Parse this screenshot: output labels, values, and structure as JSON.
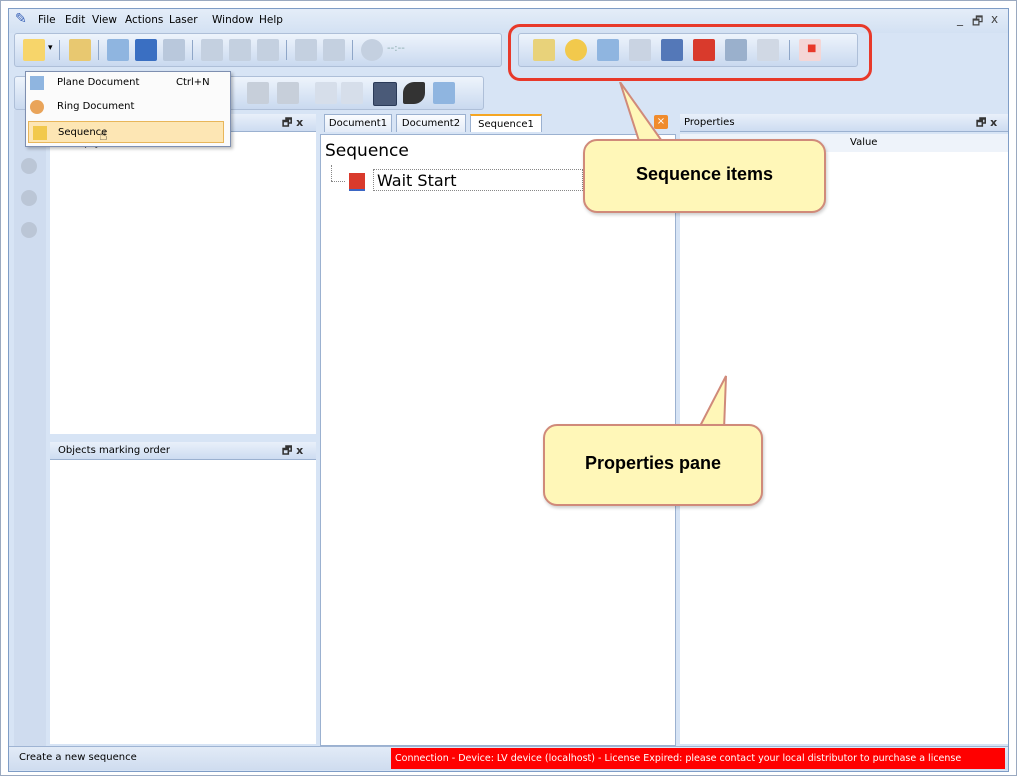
{
  "menu": {
    "items": [
      "File",
      "Edit",
      "View",
      "Actions",
      "Laser",
      "Window",
      "Help"
    ],
    "window_controls": [
      "_",
      "🗗",
      "x"
    ]
  },
  "new_menu": {
    "items": [
      {
        "label": "Plane Document",
        "shortcut": "Ctrl+N"
      },
      {
        "label": "Ring Document",
        "shortcut": ""
      },
      {
        "label": "Sequence",
        "shortcut": ""
      }
    ]
  },
  "left_pane": {
    "empty_text": "<empty>",
    "pin_close": "🗗 x"
  },
  "objects_pane": {
    "title": "Objects marking order",
    "pin_close": "🗗 x"
  },
  "tabs": [
    "Document1",
    "Document2",
    "Sequence1"
  ],
  "sequence": {
    "heading": "Sequence",
    "items": [
      "Wait Start"
    ]
  },
  "properties": {
    "title": "Properties",
    "column_value": "Value",
    "pin_close": "🗗 x"
  },
  "callouts": {
    "sequence_items": "Sequence items",
    "properties_pane": "Properties pane"
  },
  "status": {
    "left": "Create a new sequence",
    "right": "Connection - Device: LV device (localhost) - License Expired: please contact your local distributor to purchase a license"
  },
  "colors": {
    "accent_red": "#e8392a",
    "status_red": "#ff0000",
    "callout_fill": "#fff7b8"
  }
}
